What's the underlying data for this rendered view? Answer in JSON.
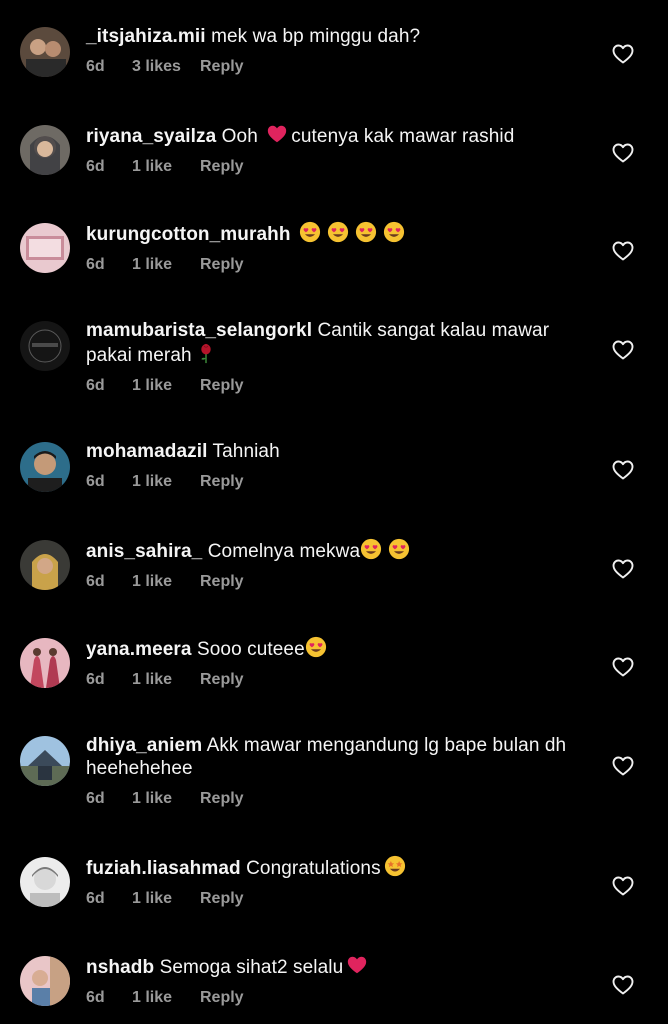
{
  "colors": {
    "background": "#000000",
    "text": "#f5f5f5",
    "meta": "#9a9a9a",
    "heart_red": "#e0245e"
  },
  "comments": [
    {
      "username": "_itsjahiza.mii",
      "text": "mek wa bp minggu dah?",
      "age": "6d",
      "likes": "3 likes",
      "reply": "Reply"
    },
    {
      "username": "riyana_syailza",
      "text_before": "Ooh ",
      "text_after": "cutenya kak mawar rashid",
      "age": "6d",
      "likes": "1 like",
      "reply": "Reply"
    },
    {
      "username": "kurungcotton_murahh",
      "text": "",
      "age": "6d",
      "likes": "1 like",
      "reply": "Reply"
    },
    {
      "username": "mamubarista_selangorkl",
      "text": "Cantik sangat kalau mawar pakai merah",
      "age": "6d",
      "likes": "1 like",
      "reply": "Reply"
    },
    {
      "username": "mohamadazil",
      "text": "Tahniah",
      "age": "6d",
      "likes": "1 like",
      "reply": "Reply"
    },
    {
      "username": "anis_sahira_",
      "text": "Comelnya mekwa",
      "age": "6d",
      "likes": "1 like",
      "reply": "Reply"
    },
    {
      "username": "yana.meera",
      "text": "Sooo cuteee",
      "age": "6d",
      "likes": "1 like",
      "reply": "Reply"
    },
    {
      "username": "dhiya_aniem",
      "text": "Akk mawar mengandung lg  bape bulan dh heehehehee",
      "age": "6d",
      "likes": "1 like",
      "reply": "Reply"
    },
    {
      "username": "fuziah.liasahmad",
      "text": "Congratulations",
      "age": "6d",
      "likes": "1 like",
      "reply": "Reply"
    },
    {
      "username": "nshadb",
      "text": "Semoga sihat2 selalu",
      "age": "6d",
      "likes": "1 like",
      "reply": "Reply"
    }
  ]
}
